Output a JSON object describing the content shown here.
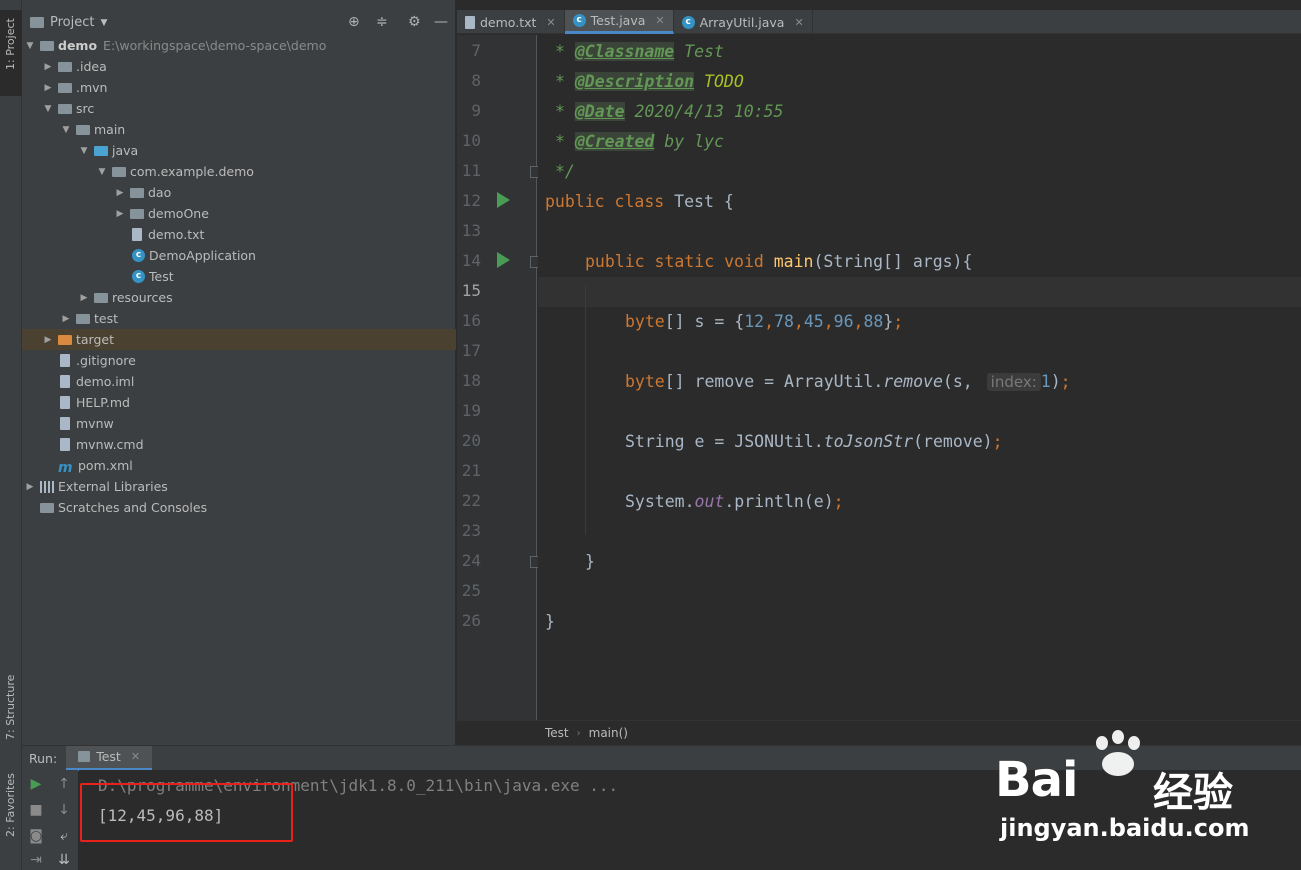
{
  "left_strip": {
    "project_tab": "1: Project",
    "structure_tab": "7: Structure",
    "favorites_tab": "2: Favorites"
  },
  "project_panel": {
    "header": "Project",
    "tree": [
      {
        "label": "demo",
        "hint": "E:\\workingspace\\demo-space\\demo"
      },
      {
        "label": ".idea"
      },
      {
        "label": ".mvn"
      },
      {
        "label": "src"
      },
      {
        "label": "main"
      },
      {
        "label": "java"
      },
      {
        "label": "com.example.demo"
      },
      {
        "label": "dao"
      },
      {
        "label": "demoOne"
      },
      {
        "label": "demo.txt"
      },
      {
        "label": "DemoApplication"
      },
      {
        "label": "Test"
      },
      {
        "label": "resources"
      },
      {
        "label": "test"
      },
      {
        "label": "target"
      },
      {
        "label": ".gitignore"
      },
      {
        "label": "demo.iml"
      },
      {
        "label": "HELP.md"
      },
      {
        "label": "mvnw"
      },
      {
        "label": "mvnw.cmd"
      },
      {
        "label": "pom.xml"
      },
      {
        "label": "External Libraries"
      },
      {
        "label": "Scratches and Consoles"
      }
    ]
  },
  "editor": {
    "tabs": [
      {
        "label": "demo.txt"
      },
      {
        "label": "Test.java"
      },
      {
        "label": "ArrayUtil.java"
      }
    ],
    "line_numbers": [
      "7",
      "8",
      "9",
      "10",
      "11",
      "12",
      "13",
      "14",
      "15",
      "16",
      "17",
      "18",
      "19",
      "20",
      "21",
      "22",
      "23",
      "24",
      "25",
      "26"
    ],
    "code": {
      "l7_star": "* ",
      "l7_tag": "@Classname",
      "l7_text": " Test",
      "l8_star": "* ",
      "l8_tag": "@Description",
      "l8_text": " TODO",
      "l9_star": "* ",
      "l9_tag": "@Date",
      "l9_text": " 2020/4/13 10:55",
      "l10_star": "* ",
      "l10_tag": "@Created",
      "l10_text": " by lyc",
      "l11": "*/",
      "l12_kw": "public class",
      "l12_rest": " Test {",
      "l14_kw": "public static void",
      "l14_fn": " main",
      "l14_rest": "(String[] args){",
      "l16_kw": "byte",
      "l16_a": "[] s = {",
      "l16_n1": "12",
      "l16_n2": "78",
      "l16_n3": "45",
      "l16_n4": "96",
      "l16_n5": "88",
      "l16_end": "}",
      "l18_kw": "byte",
      "l18_a": "[] remove = ArrayUtil.",
      "l18_call": "remove",
      "l18_b": "(s, ",
      "l18_hint": "index:",
      "l18_n": "1",
      "l18_c": ")",
      "l20_a": "String e = JSONUtil.",
      "l20_call": "toJsonStr",
      "l20_b": "(remove)",
      "l22_a": "System.",
      "l22_field": "out",
      "l22_b": ".println(e)",
      "semicolon": ";",
      "comma": ",",
      "brace_close": "}"
    }
  },
  "breadcrumb": [
    "Test",
    "main()"
  ],
  "run": {
    "label": "Run:",
    "tab": "Test",
    "console_cmd": "D:\\programme\\environment\\jdk1.8.0_211\\bin\\java.exe ...",
    "console_out": "[12,45,96,88]"
  },
  "watermark": {
    "brand_left": "Bai",
    "brand_right": "经验",
    "url": "jingyan.baidu.com"
  },
  "colors": {
    "highlight_box": "#e8221b",
    "accent": "#4a88c7",
    "run_green": "#499c54"
  }
}
